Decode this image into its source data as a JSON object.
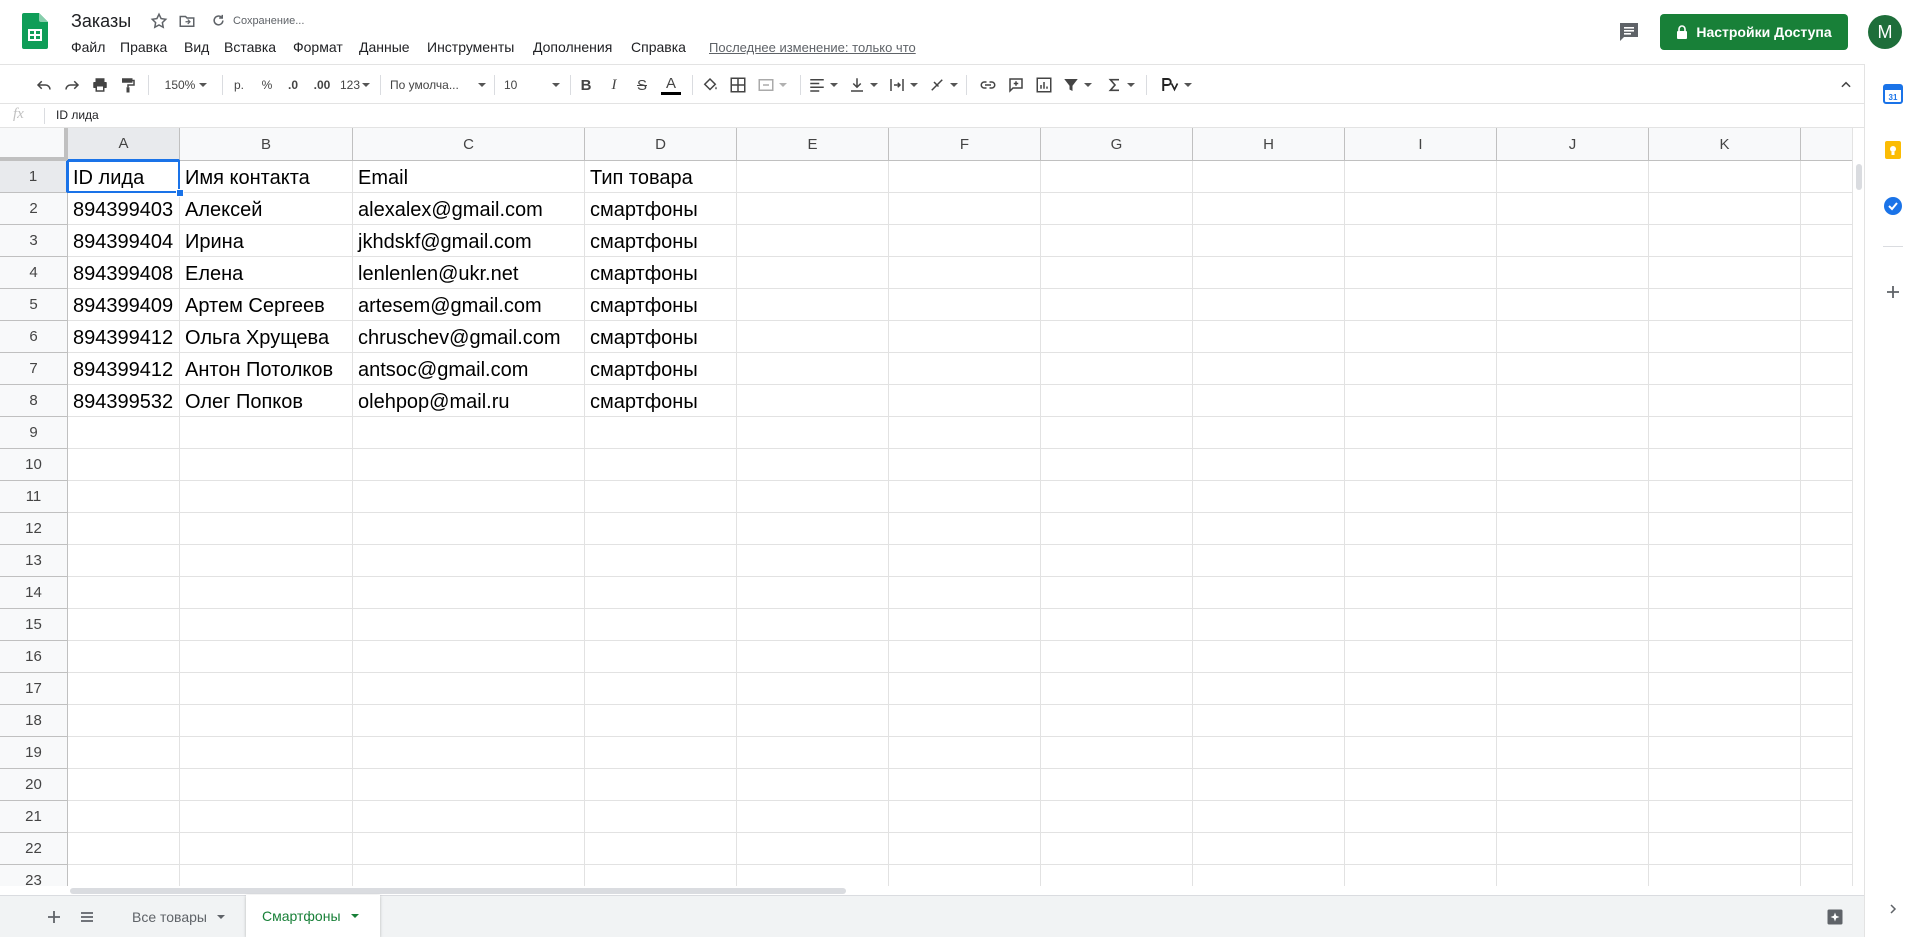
{
  "header": {
    "doc_title": "Заказы",
    "save_status": "Сохранение...",
    "last_edit": "Последнее изменение: только что",
    "share_label": "Настройки Доступа",
    "avatar_letter": "M",
    "menu": [
      "Файл",
      "Правка",
      "Вид",
      "Вставка",
      "Формат",
      "Данные",
      "Инструменты",
      "Дополнения",
      "Справка"
    ]
  },
  "toolbar": {
    "zoom": "150%",
    "currency": "р.",
    "percent": "%",
    "dec_decrease": ".0",
    "dec_increase": ".00",
    "number_format": "123",
    "font": "По умолча...",
    "font_size": "10",
    "bold": "B",
    "italic": "I",
    "strike": "S",
    "text_color_letter": "A"
  },
  "formula_bar": {
    "fx": "fx",
    "value": "ID лида"
  },
  "grid": {
    "columns": [
      "A",
      "B",
      "C",
      "D",
      "E",
      "F",
      "G",
      "H",
      "I",
      "J",
      "K"
    ],
    "rows": [
      "1",
      "2",
      "3",
      "4",
      "5",
      "6",
      "7",
      "8",
      "9",
      "10",
      "11",
      "12",
      "13",
      "14",
      "15",
      "16",
      "17",
      "18",
      "19",
      "20",
      "21",
      "22",
      "23"
    ],
    "cells": [
      [
        "ID лида",
        "Имя контакта",
        "Email",
        "Тип товара"
      ],
      [
        "894399403",
        "Алексей",
        "alexalex@gmail.com",
        "смартфоны"
      ],
      [
        "894399404",
        "Ирина",
        "jkhdskf@gmail.com",
        "смартфоны"
      ],
      [
        "894399408",
        "Елена",
        "lenlenlen@ukr.net",
        "смартфоны"
      ],
      [
        "894399409",
        "Артем Сергеев",
        "artesem@gmail.com",
        "смартфоны"
      ],
      [
        "894399412",
        "Ольга Хрущева",
        "chruschev@gmail.com",
        "смартфоны"
      ],
      [
        "894399412",
        "Антон Потолков",
        "antsoc@gmail.com",
        "смартфоны"
      ],
      [
        "894399532",
        "Олег Попков",
        "olehpop@mail.ru",
        "смартфоны"
      ]
    ]
  },
  "sheets": {
    "tabs": [
      "Все товары",
      "Смартфоны"
    ],
    "active": "Смартфоны"
  },
  "colors": {
    "brand_green": "#188038",
    "selection_blue": "#1a73e8"
  }
}
